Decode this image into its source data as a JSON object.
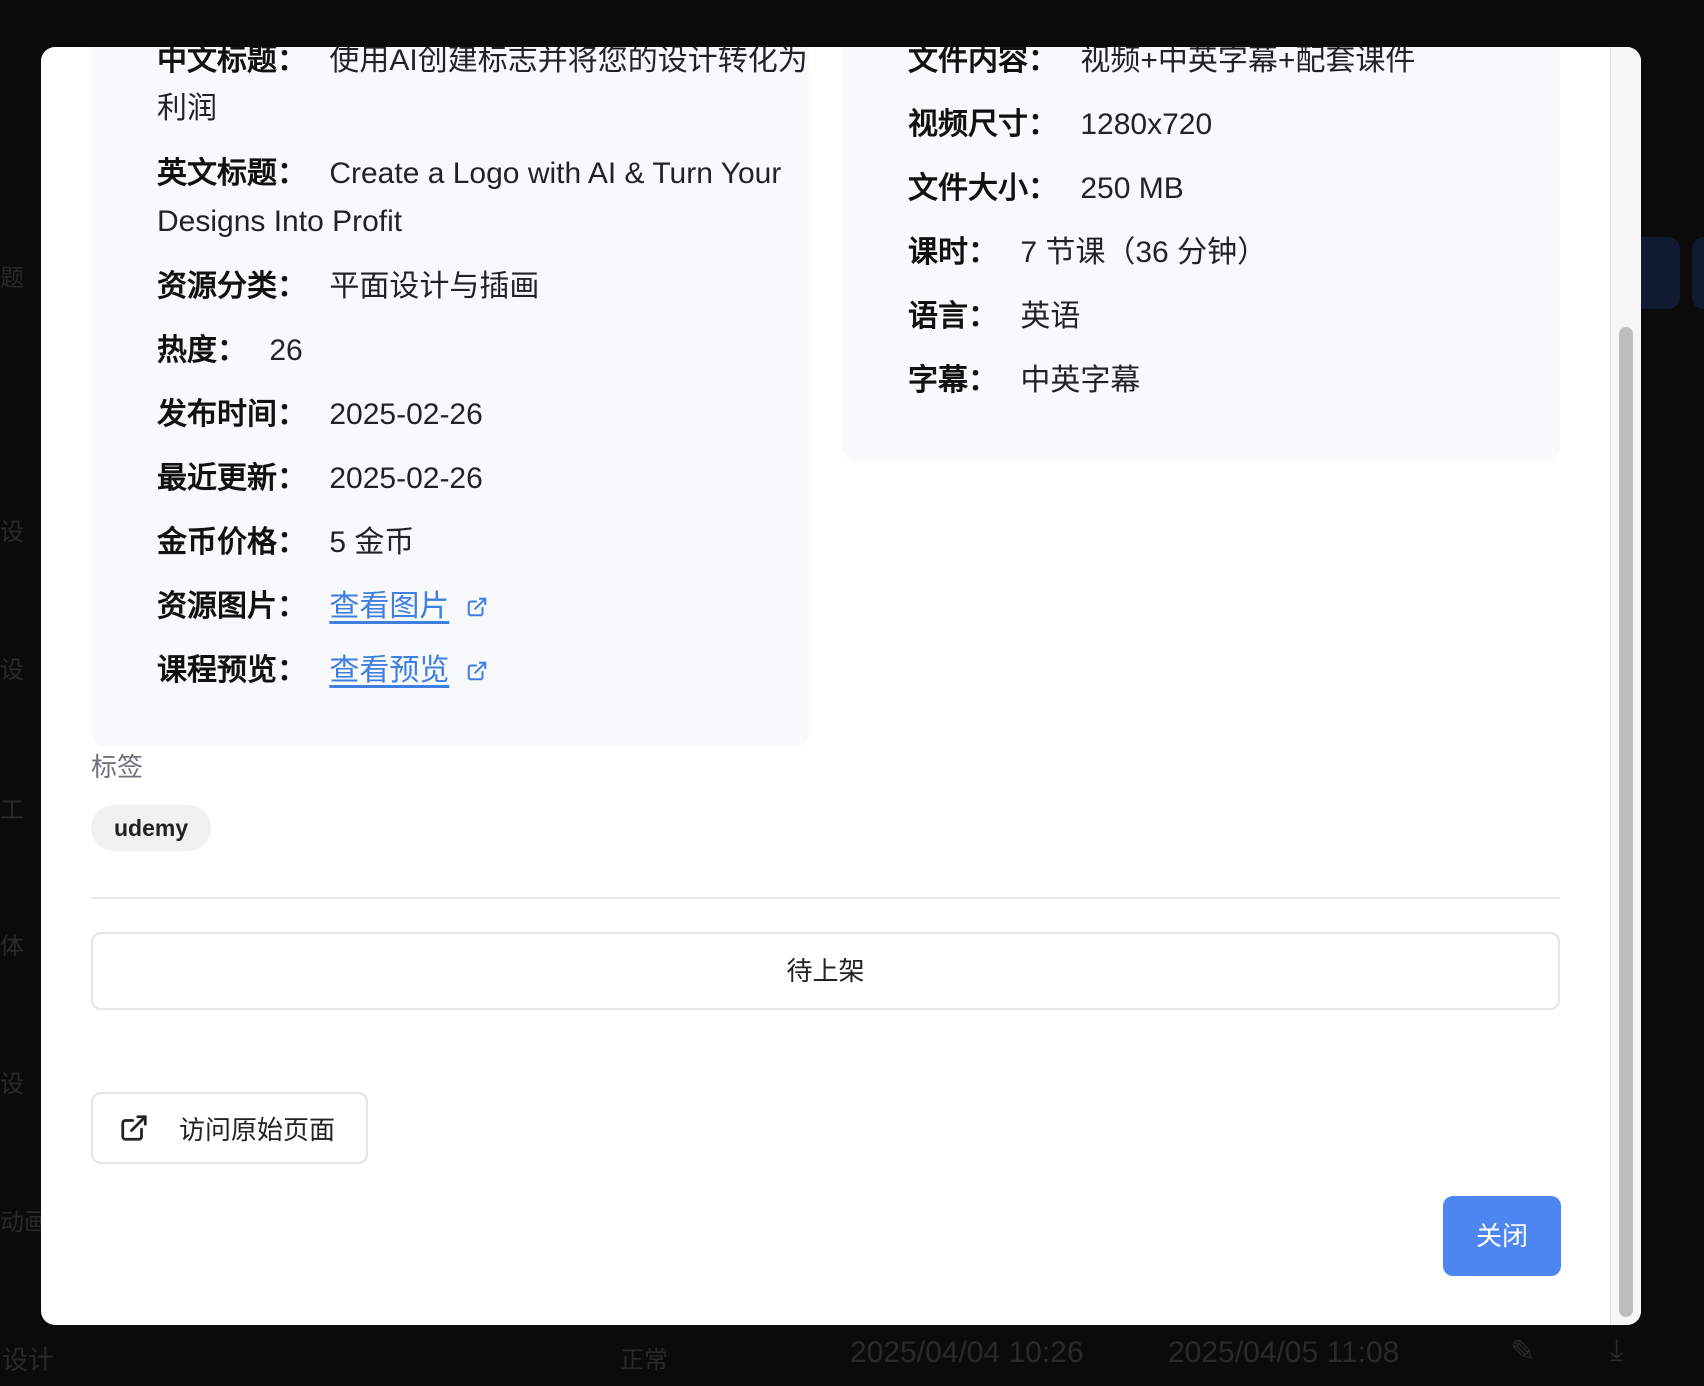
{
  "background": {
    "rows": [
      "题",
      "设",
      "设",
      "工",
      "体",
      "设",
      "动画"
    ],
    "bottom_row": {
      "name": "设计",
      "status": "正常",
      "created": "2025/04/04 10:26",
      "updated": "2025/04/05 11:08"
    }
  },
  "left_panel": {
    "cn_title_label": "中文标题：",
    "cn_title_value_line1": "使用AI创建标志并将您的设计转化为",
    "cn_title_value_line2": "利润",
    "en_title_label": "英文标题：",
    "en_title_value_line1": "Create a Logo with AI & Turn Your",
    "en_title_value_line2": "Designs Into Profit",
    "category_label": "资源分类：",
    "category_value": "平面设计与插画",
    "heat_label": "热度：",
    "heat_value": "26",
    "publish_label": "发布时间：",
    "publish_value": "2025-02-26",
    "updated_label": "最近更新：",
    "updated_value": "2025-02-26",
    "price_label": "金币价格：",
    "price_value": "5 金币",
    "image_label": "资源图片：",
    "image_link": "查看图片",
    "preview_label": "课程预览：",
    "preview_link": "查看预览"
  },
  "right_panel": {
    "content_label": "文件内容：",
    "content_value": "视频+中英字幕+配套课件",
    "size_label": "视频尺寸：",
    "size_value": "1280x720",
    "filesize_label": "文件大小：",
    "filesize_value": "250 MB",
    "lessons_label": "课时：",
    "lessons_value": "7 节课（36 分钟）",
    "language_label": "语言：",
    "language_value": "英语",
    "subtitle_label": "字幕：",
    "subtitle_value": "中英字幕"
  },
  "tags": {
    "label": "标签",
    "items": [
      "udemy"
    ]
  },
  "status_text": "待上架",
  "visit_button": "访问原始页面",
  "close_button": "关闭",
  "colors": {
    "accent": "#4d86f0",
    "link": "#3f7fe0",
    "panel_bg": "#f8f9fb"
  }
}
